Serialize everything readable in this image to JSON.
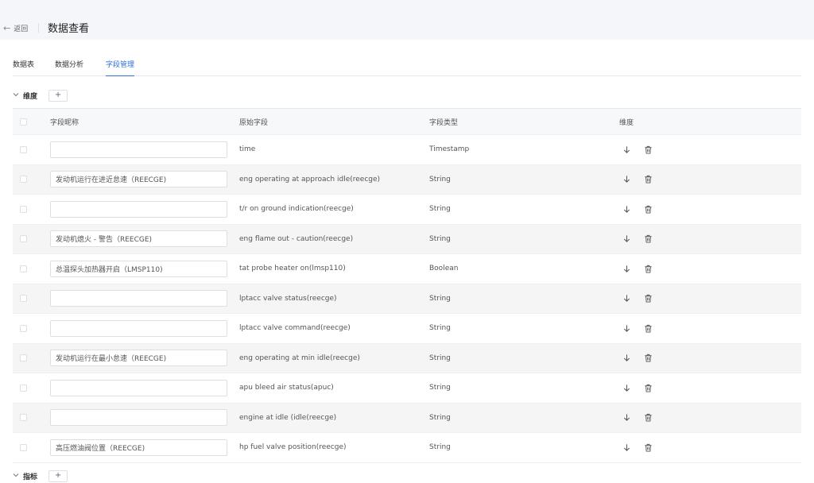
{
  "header": {
    "back_label": "返回",
    "title": "数据查看"
  },
  "tabs": [
    {
      "label": "数据表",
      "active": false
    },
    {
      "label": "数据分析",
      "active": false
    },
    {
      "label": "字段管理",
      "active": true
    }
  ],
  "dimension_section": {
    "label": "维度",
    "add_label": "+"
  },
  "metric_section": {
    "label": "指标",
    "add_label": "+"
  },
  "table": {
    "columns": [
      "字段昵称",
      "原始字段",
      "字段类型",
      "维度"
    ],
    "rows": [
      {
        "alias": "",
        "raw": "time",
        "type": "Timestamp"
      },
      {
        "alias": "发动机运行在进近怠速（REECGE)",
        "raw": "eng operating at approach idle(reecge)",
        "type": "String"
      },
      {
        "alias": "",
        "raw": "t/r on ground indication(reecge)",
        "type": "String"
      },
      {
        "alias": "发动机熄火 - 警告（REECGE)",
        "raw": "eng flame out - caution(reecge)",
        "type": "String"
      },
      {
        "alias": "总温探头加热器开启（LMSP110)",
        "raw": "tat probe heater on(lmsp110)",
        "type": "Boolean"
      },
      {
        "alias": "",
        "raw": "lptacc valve status(reecge)",
        "type": "String"
      },
      {
        "alias": "",
        "raw": "lptacc valve command(reecge)",
        "type": "String"
      },
      {
        "alias": "发动机运行在最小怠速（REECGE)",
        "raw": "eng operating at min idle(reecge)",
        "type": "String"
      },
      {
        "alias": "",
        "raw": "apu bleed air status(apuc)",
        "type": "String"
      },
      {
        "alias": "",
        "raw": "engine at idle (idle(reecge)",
        "type": "String"
      },
      {
        "alias": "高压燃油阀位置（REECGE)",
        "raw": "hp fuel valve position(reecge)",
        "type": "String"
      }
    ]
  },
  "icons": {
    "back": "left-arrow-icon",
    "collapse": "chevron-down-icon",
    "move": "down-arrow-icon",
    "delete": "trash-icon"
  },
  "colors": {
    "accent": "#2f6fde",
    "row_alt": "#f5f5f5",
    "page_bg": "#f0f2f5"
  }
}
